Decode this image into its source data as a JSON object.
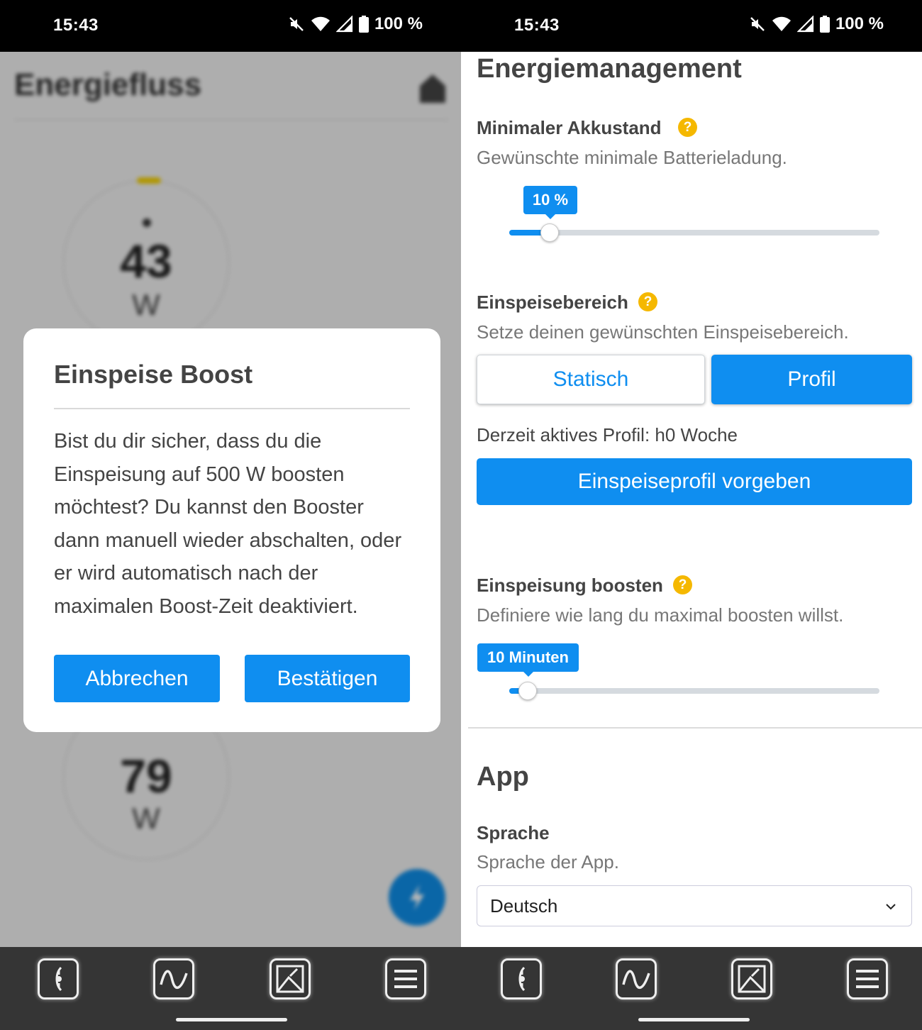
{
  "status_bar": {
    "time": "15:43",
    "battery": "100 %"
  },
  "left": {
    "background": {
      "title": "Energiefluss",
      "ring1": {
        "value": "43",
        "unit": "W"
      },
      "ring2": {
        "value": "79",
        "unit": "W"
      }
    },
    "dialog": {
      "title": "Einspeise Boost",
      "body": "Bist du dir sicher, dass du die Einspeisung auf 500 W boosten möchtest? Du kannst den Booster dann manuell wieder abschalten, oder er wird automatisch nach der maximalen Boost-Zeit deaktiviert.",
      "cancel_label": "Abbrechen",
      "confirm_label": "Bestätigen"
    }
  },
  "right": {
    "section_title": "Energiemanagement",
    "min_battery": {
      "label": "Minimaler Akkustand",
      "help": "?",
      "description": "Gewünschte minimale Batterieladung.",
      "value_label": "10 %",
      "value_fraction": 0.11
    },
    "feed_range": {
      "label": "Einspeisebereich",
      "help": "?",
      "description": "Setze deinen gewünschten Einspeisebereich.",
      "options": [
        "Statisch",
        "Profil"
      ],
      "selected": "Profil",
      "active_profile": "Derzeit aktives Profil: h0 Woche",
      "set_profile_label": "Einspeiseprofil vorgeben"
    },
    "boost": {
      "label": "Einspeisung boosten",
      "help": "?",
      "description": "Definiere wie lang du maximal boosten willst.",
      "value_label": "10 Minuten",
      "value_fraction": 0.05
    },
    "app_section": {
      "title": "App",
      "language": {
        "label": "Sprache",
        "description": "Sprache der App.",
        "value": "Deutsch"
      }
    }
  },
  "nav": {
    "items": [
      "energy-flow-icon",
      "chart-icon",
      "statistics-icon",
      "menu-icon"
    ]
  },
  "colors": {
    "accent": "#0f8ef0",
    "help": "#f5b800",
    "navbar": "#353535"
  }
}
